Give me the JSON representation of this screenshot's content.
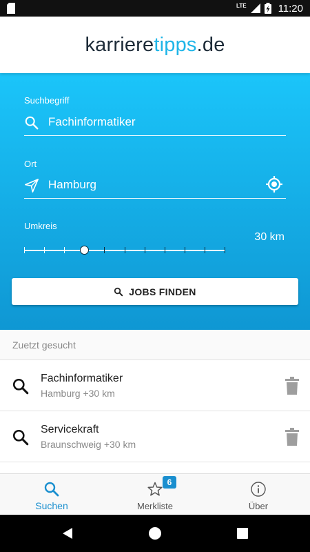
{
  "status_bar": {
    "network": "LTE",
    "time": "11:20"
  },
  "header": {
    "logo_main": "karriere",
    "logo_accent": "tipps",
    "logo_suffix": ".de",
    "accent_color": "#1fb5e8"
  },
  "search": {
    "keyword_label": "Suchbegriff",
    "keyword_value": "Fachinformatiker",
    "location_label": "Ort",
    "location_value": "Hamburg",
    "radius_label": "Umkreis",
    "radius_value": "30 km",
    "radius_slider_position": 0.3,
    "submit_label": "JOBS FINDEN",
    "panel_color_top": "#1bc5fa",
    "panel_color_bottom": "#0f97d3"
  },
  "recent": {
    "heading": "Zuetzt gesucht",
    "items": [
      {
        "title": "Fachinformatiker",
        "subtitle": "Hamburg +30 km"
      },
      {
        "title": "Servicekraft",
        "subtitle": "Braunschweig +30 km"
      }
    ]
  },
  "bottom_nav": {
    "items": [
      {
        "label": "Suchen",
        "icon": "search-icon",
        "active": true
      },
      {
        "label": "Merkliste",
        "icon": "star-icon",
        "badge": "6"
      },
      {
        "label": "Über",
        "icon": "info-icon"
      }
    ],
    "active_color": "#1a8fcf"
  }
}
